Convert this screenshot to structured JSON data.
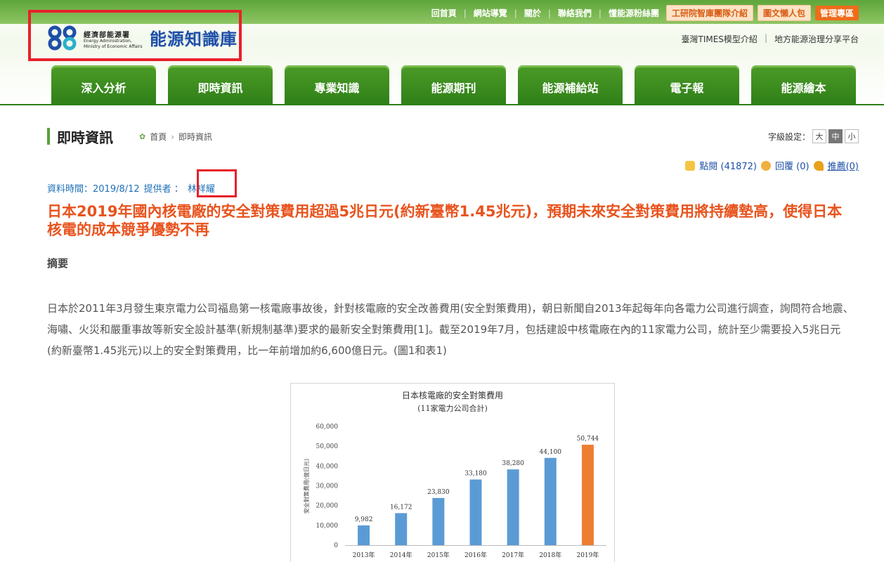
{
  "header": {
    "top_links": [
      "回首頁",
      "網站導覽",
      "關於",
      "聯絡我們",
      "懂能源粉絲團"
    ],
    "buttons": {
      "itri": "工研院智庫團隊介紹",
      "lazy": "圖文懶人包",
      "admin": "管理專區"
    },
    "logo": {
      "cn": "經濟部能源署",
      "en1": "Energy Administration,",
      "en2": "Ministry of Economic Affairs",
      "title": "能源知識庫"
    },
    "sub_links": [
      "臺灣TIMES模型介紹",
      "地方能源治理分享平台"
    ]
  },
  "nav": {
    "tabs": [
      "深入分析",
      "即時資訊",
      "專業知識",
      "能源期刊",
      "能源補給站",
      "電子報",
      "能源繪本"
    ]
  },
  "page": {
    "title": "即時資訊",
    "breadcrumb": [
      "首頁",
      "即時資訊"
    ],
    "font_size_label": "字級設定：",
    "font_sizes": [
      "大",
      "中",
      "小"
    ],
    "font_size_selected": "中"
  },
  "stats": {
    "views": "點閱 (41872)",
    "replies": "回覆 (0)",
    "recommend": "推薦(0)"
  },
  "meta": {
    "date": "資料時間：2019/8/12",
    "provider_label": "提供者 ：",
    "provider": "林祥耀"
  },
  "article": {
    "headline": "日本2019年國內核電廠的安全對策費用超過5兆日元(約新臺幣1.45兆元)，預期未來安全對策費用將持續墊高，使得日本核電的成本競爭優勢不再",
    "summary_label": "摘要",
    "body": "日本於2011年3月發生東京電力公司福島第一核電廠事故後，針對核電廠的安全改善費用(安全對策費用)，朝日新聞自2013年起每年向各電力公司進行調查，詢問符合地震、海嘯、火災和嚴重事故等新安全設計基準(新規制基準)要求的最新安全對策費用[1]。截至2019年7月，包括建設中核電廠在內的11家電力公司，統計至少需要投入5兆日元(約新臺幣1.45兆元)以上的安全對策費用，比一年前增加約6,600億日元。(圖1和表1)"
  },
  "colors": {
    "green": "#2e7f17",
    "orange": "#e8531d",
    "blue": "#1e6fb8",
    "bar_blue": "#5b9bd5",
    "bar_orange": "#ed7d31"
  },
  "chart_data": {
    "type": "bar",
    "title": "日本核電廠的安全對策費用",
    "subtitle": "(11家電力公司合計)",
    "ylabel": "安全對策費用(億日元)",
    "categories": [
      "2013年",
      "2014年",
      "2015年",
      "2016年",
      "2017年",
      "2018年",
      "2019年"
    ],
    "values": [
      9982,
      16172,
      23830,
      33180,
      38280,
      44100,
      50744
    ],
    "value_labels": [
      "9,982",
      "16,172",
      "23,830",
      "33,180",
      "38,280",
      "44,100",
      "50,744"
    ],
    "ylim": [
      0,
      60000
    ],
    "yticks": [
      "0",
      "10,000",
      "20,000",
      "30,000",
      "40,000",
      "50,000",
      "60,000"
    ],
    "highlight_last": true,
    "grid": false
  }
}
